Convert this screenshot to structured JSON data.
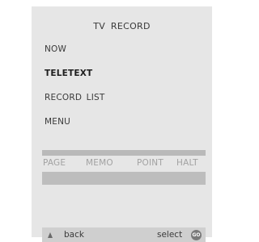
{
  "screen": {
    "title": "TV RECORD"
  },
  "menu": {
    "items": [
      {
        "label": "NOW"
      },
      {
        "label": "TELETEXT",
        "selected": true
      },
      {
        "label": "RECORD LIST"
      },
      {
        "label": "MENU"
      }
    ]
  },
  "function_keys": {
    "labels": [
      "PAGE",
      "MEMO",
      "POINT",
      "HALT"
    ]
  },
  "footer": {
    "back_icon": "up-arrow-icon",
    "back_label": "back",
    "select_label": "select",
    "go_icon": "go-button-icon",
    "go_text": "GO"
  },
  "colors": {
    "panel_background": "#e6e6e6",
    "bar_grey": "#bdbdbd",
    "footer_bar": "#cfcfcf",
    "text": "#3a3a3a",
    "inactive_text": "#a2a2a2"
  }
}
